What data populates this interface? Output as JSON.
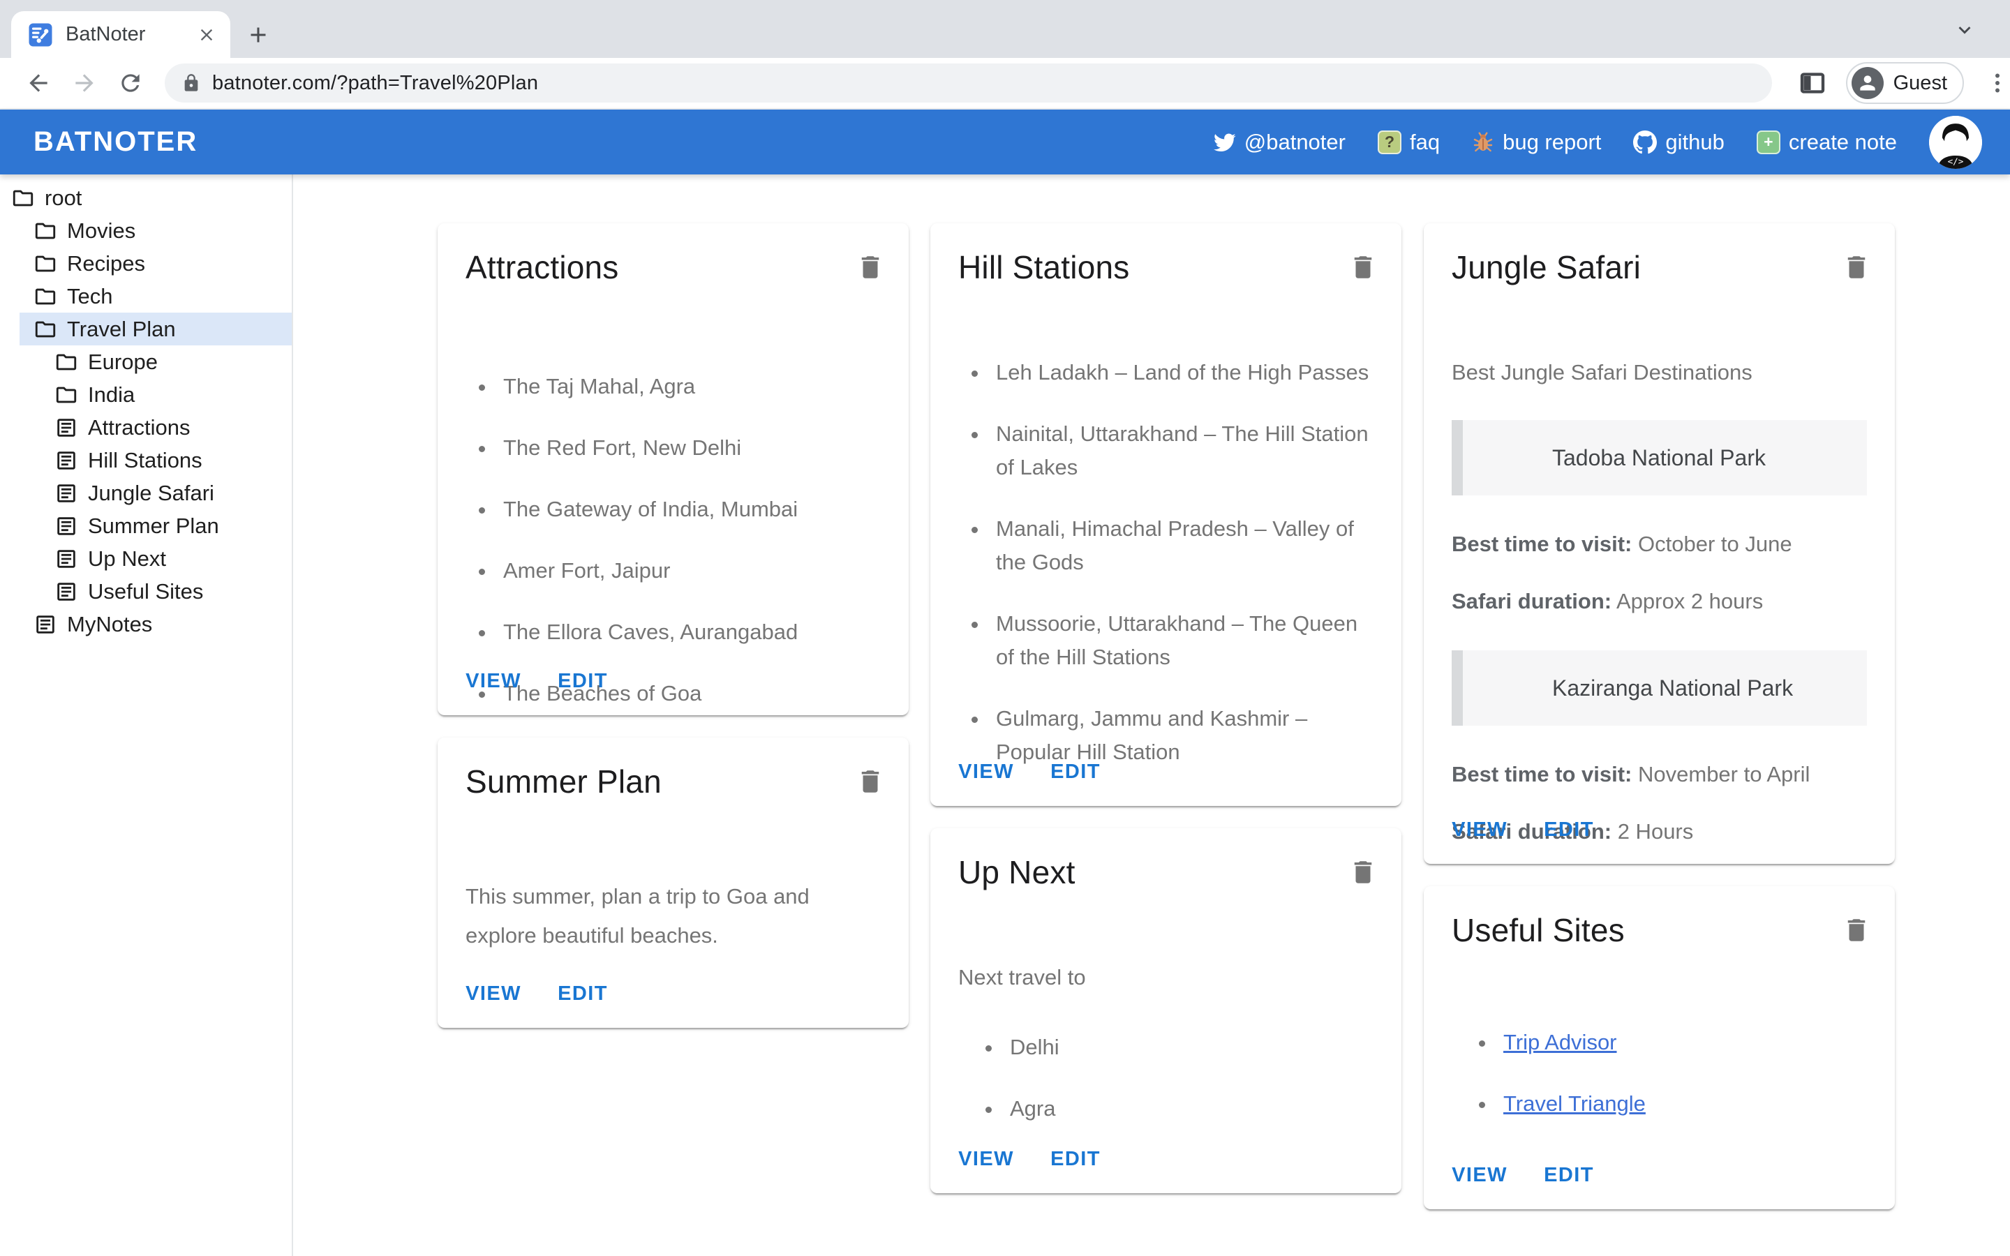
{
  "theme": {
    "appbar_blue": "#2f76d3",
    "action_blue": "#1976d2",
    "link_blue": "#3d6fd6",
    "selected_row_bg": "#dbe7f8"
  },
  "browser": {
    "tab_title": "BatNoter",
    "url": "batnoter.com/?path=Travel%20Plan",
    "profile_label": "Guest"
  },
  "appbar": {
    "brand": "BATNOTER",
    "links": {
      "twitter": "@batnoter",
      "faq": "faq",
      "bug": "bug report",
      "github": "github",
      "create": "create note"
    }
  },
  "sidebar": {
    "items": [
      {
        "label": "root"
      },
      {
        "label": "Movies"
      },
      {
        "label": "Recipes"
      },
      {
        "label": "Tech"
      },
      {
        "label": "Travel Plan"
      },
      {
        "label": "Europe"
      },
      {
        "label": "India"
      },
      {
        "label": "Attractions"
      },
      {
        "label": "Hill Stations"
      },
      {
        "label": "Jungle Safari"
      },
      {
        "label": "Summer Plan"
      },
      {
        "label": "Up Next"
      },
      {
        "label": "Useful Sites"
      },
      {
        "label": "MyNotes"
      }
    ]
  },
  "actions": {
    "view": "VIEW",
    "edit": "EDIT"
  },
  "cards": {
    "attractions": {
      "title": "Attractions",
      "items": [
        "The Taj Mahal, Agra",
        "The Red Fort, New Delhi",
        "The Gateway of India, Mumbai",
        "Amer Fort, Jaipur",
        "The Ellora Caves, Aurangabad",
        "The Beaches of Goa"
      ]
    },
    "hill_stations": {
      "title": "Hill Stations",
      "items": [
        "Leh Ladakh – Land of the High Passes",
        "Nainital, Uttarakhand – The Hill Station of Lakes",
        "Manali, Himachal Pradesh – Valley of the Gods",
        "Mussoorie, Uttarakhand – The Queen of the Hill Stations",
        "Gulmarg, Jammu and Kashmir – Popular Hill Station"
      ]
    },
    "jungle_safari": {
      "title": "Jungle Safari",
      "intro": "Best Jungle Safari Destinations",
      "park1": {
        "name": "Tadoba National Park",
        "best_label": "Best time to visit:",
        "best_value": " October to June",
        "duration_label": "Safari duration:",
        "duration_value": " Approx 2 hours"
      },
      "park2": {
        "name": "Kaziranga National Park",
        "best_label": "Best time to visit:",
        "best_value": " November to April",
        "duration_label": "Safari duration:",
        "duration_value": " 2 Hours"
      }
    },
    "summer_plan": {
      "title": "Summer Plan",
      "body": "This summer, plan a trip to Goa and explore beautiful beaches."
    },
    "up_next": {
      "title": "Up Next",
      "intro": "Next travel to",
      "items": [
        "Delhi",
        "Agra"
      ]
    },
    "useful_sites": {
      "title": "Useful Sites",
      "links": [
        "Trip Advisor",
        "Travel Triangle"
      ]
    }
  }
}
